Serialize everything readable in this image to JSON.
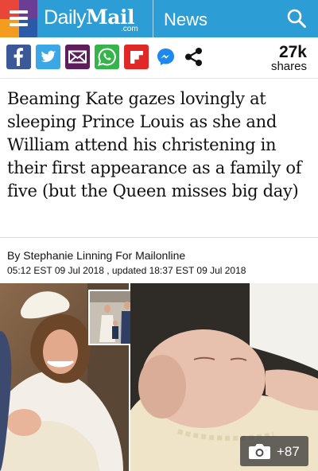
{
  "header": {
    "logo_prefix": "Daily",
    "logo_main": "Mail",
    "logo_suffix": ".com",
    "section": "News"
  },
  "share": {
    "count": "27k",
    "label": "shares",
    "buttons": [
      "facebook-icon",
      "twitter-icon",
      "email-icon",
      "whatsapp-icon",
      "flipboard-icon",
      "messenger-icon",
      "share-icon"
    ],
    "colors": {
      "facebook": "#3b5998",
      "twitter": "#3aa8e6",
      "email": "#5c1f5c",
      "whatsapp": "#35b44a",
      "flipboard": "#e12828",
      "messenger": "#1f88f0",
      "header": "#2c9ed5"
    }
  },
  "article": {
    "headline": "Beaming Kate gazes lovingly at sleeping Prince Louis as she and William attend his christening in their first appearance as a family of five (but the Queen misses big day)",
    "byline": "By Stephanie Linning For Mailonline",
    "dateline": "05:12 EST 09 Jul 2018 , updated 18:37 EST 09 Jul 2018"
  },
  "gallery": {
    "count": "+87"
  }
}
